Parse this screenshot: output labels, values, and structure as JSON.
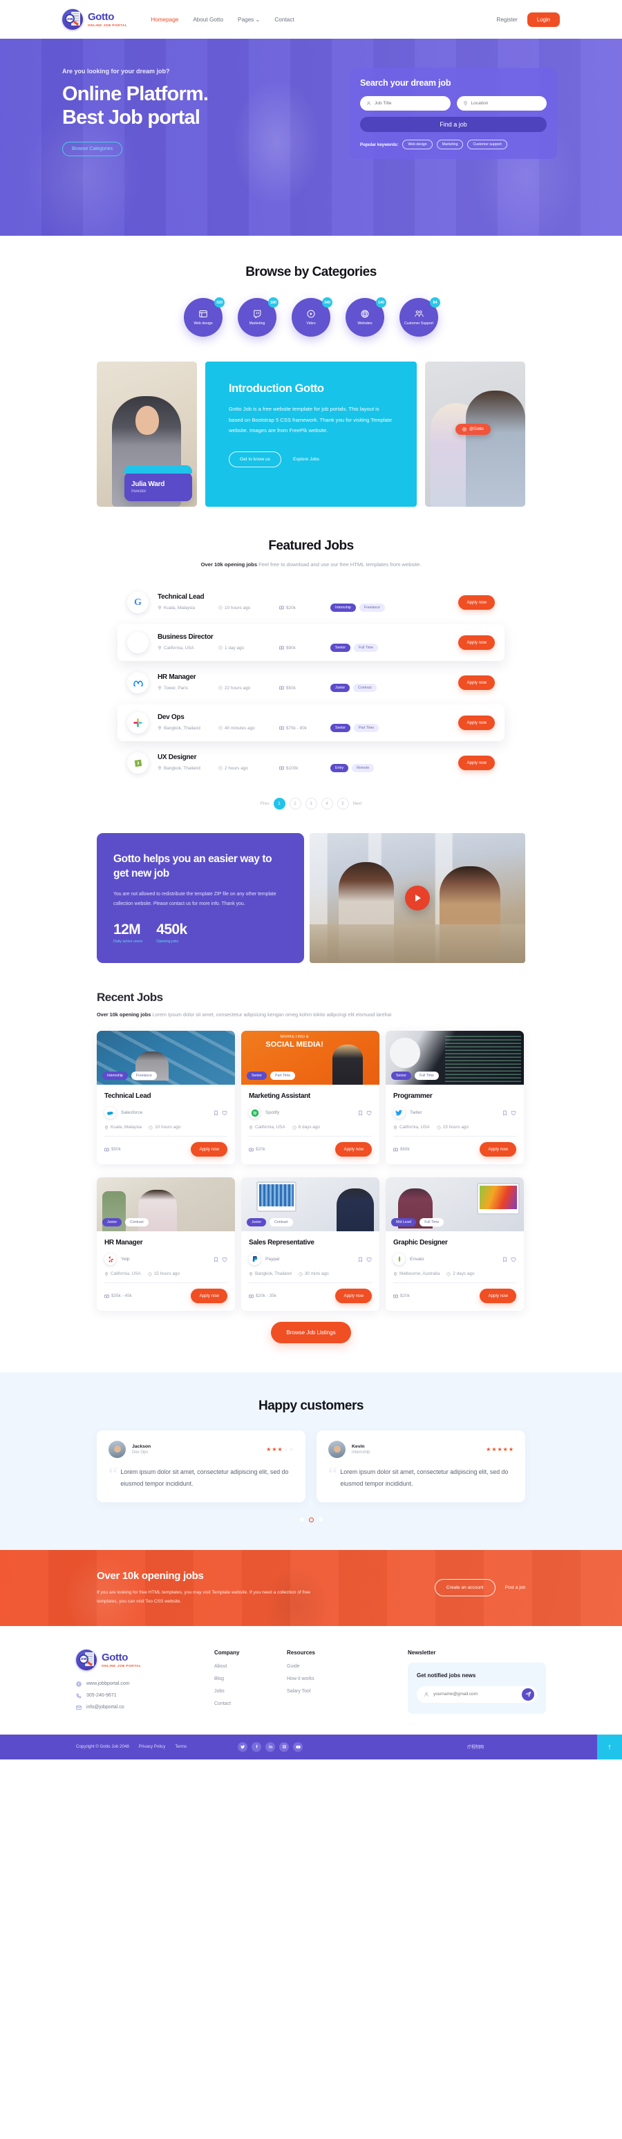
{
  "nav": {
    "brand": {
      "name": "Gotto",
      "tagline": "ONLINE JOB PORTAL"
    },
    "links": [
      {
        "label": "Homepage",
        "active": true
      },
      {
        "label": "About Gotto",
        "active": false
      },
      {
        "label": "Pages",
        "active": false,
        "caret": true
      },
      {
        "label": "Contact",
        "active": false
      }
    ],
    "register_label": "Register",
    "login_label": "Login"
  },
  "hero": {
    "kicker": "Are you looking for your dream job?",
    "title_line1": "Online Platform.",
    "title_line2": "Best Job portal",
    "browse_button": "Browse Categories",
    "search": {
      "title": "Search your dream job",
      "job_placeholder": "Job Title",
      "location_placeholder": "Location",
      "find_label": "Find a job",
      "keywords_label": "Popular keywords:",
      "keywords": [
        "Web design",
        "Marketing",
        "Customer support"
      ]
    }
  },
  "categories": {
    "title": "Browse by Categories",
    "items": [
      {
        "label": "Web design",
        "count": "320",
        "icon": "window-icon"
      },
      {
        "label": "Marketing",
        "count": "180",
        "icon": "twitch-icon"
      },
      {
        "label": "Video",
        "count": "340",
        "icon": "play-icon"
      },
      {
        "label": "Websites",
        "count": "140",
        "icon": "globe-icon"
      },
      {
        "label": "Customer Support",
        "count": "84",
        "icon": "people-icon"
      }
    ]
  },
  "intro": {
    "person_name": "Julia Ward",
    "person_role": "Investor",
    "title": "Introduction Gotto",
    "body": "Gotto Job is a free website template for job portals. This layout is based on Bootstrap 5 CSS framework. Thank you for visiting Template website. Images are from FreePik website.",
    "primary_button": "Get to know us",
    "secondary_link": "Explore Jobs",
    "instagram_chip": "@Gotto"
  },
  "featured": {
    "title": "Featured Jobs",
    "sub_bold": "Over 10k opening jobs",
    "sub_rest": " Feel free to download and use our free HTML templates from website.",
    "apply_label": "Apply now",
    "jobs": [
      {
        "title": "Technical Lead",
        "location": "Kuala, Malaysia",
        "time": "10 hours ago",
        "pay": "$20k",
        "tag_solid": "Internship",
        "tag_soft": "Freelance",
        "logo": "google-icon"
      },
      {
        "title": "Business Director",
        "location": "California, USA",
        "time": "1 day ago",
        "pay": "$90k",
        "tag_solid": "Senior",
        "tag_soft": "Full Time",
        "logo": "apple-icon"
      },
      {
        "title": "HR Manager",
        "location": "Tower, Paris",
        "time": "22 hours ago",
        "pay": "$50k",
        "tag_solid": "Junior",
        "tag_soft": "Contract",
        "logo": "meta-icon"
      },
      {
        "title": "Dev Ops",
        "location": "Bangkok, Thailand",
        "time": "40 minutes ago",
        "pay": "$75k - 80k",
        "tag_solid": "Senior",
        "tag_soft": "Part Time",
        "logo": "slack-icon"
      },
      {
        "title": "UX Designer",
        "location": "Bangkok, Thailand",
        "time": "2 hours ago",
        "pay": "$100k",
        "tag_solid": "Entry",
        "tag_soft": "Remote",
        "logo": "envato-icon"
      }
    ],
    "pagination": {
      "prev": "Prev",
      "pages": [
        "1",
        "2",
        "3",
        "4",
        "5"
      ],
      "current": "1",
      "next": "Next"
    }
  },
  "promo": {
    "title": "Gotto helps you an easier way to get new job",
    "body": "You are not allowed to redistribute the template ZIP file on any other template collection website. Please contact us for more info. Thank you.",
    "stats": [
      {
        "value": "12M",
        "label": "Daily active users"
      },
      {
        "value": "450k",
        "label": "Opening jobs"
      }
    ],
    "play_icon": "youtube-play-icon"
  },
  "recent": {
    "title": "Recent Jobs",
    "sub_bold": "Over 10k opening jobs",
    "sub_rest": " Lorem Ipsum dolor sit amet, consectetur adipsicing kengan omeg kohm tokito adipcingi elit eismuod larehai",
    "apply_label": "Apply now",
    "browse_label": "Browse Job Listings",
    "cards": [
      {
        "title": "Technical Lead",
        "company": "Salesforce",
        "location": "Kuala, Malaysia",
        "time": "10 hours ago",
        "pay": "$50k",
        "tag_solid": "Internship",
        "tag_soft": "Freelance",
        "logo": "salesforce-icon"
      },
      {
        "title": "Marketing Assistant",
        "company": "Spotify",
        "location": "California, USA",
        "time": "8 days ago",
        "pay": "$20k",
        "tag_solid": "Senior",
        "tag_soft": "Part Time",
        "logo": "spotify-icon"
      },
      {
        "title": "Programmer",
        "company": "Twiter",
        "location": "California, USA",
        "time": "23 hours ago",
        "pay": "$68k",
        "tag_solid": "Senior",
        "tag_soft": "Full Time",
        "logo": "twitter-icon"
      },
      {
        "title": "HR Manager",
        "company": "Yelp",
        "location": "California, USA",
        "time": "15 hours ago",
        "pay": "$35k - 45k",
        "tag_solid": "Junior",
        "tag_soft": "Contract",
        "logo": "yelp-icon"
      },
      {
        "title": "Sales Representative",
        "company": "Paypal",
        "location": "Bangkok, Thailand",
        "time": "30 mins ago",
        "pay": "$20k - 35k",
        "tag_solid": "Junior",
        "tag_soft": "Contract",
        "logo": "paypal-icon"
      },
      {
        "title": "Graphic Designer",
        "company": "Envato",
        "location": "Melbourne, Australia",
        "time": "2 days ago",
        "pay": "$20k",
        "tag_solid": "Mid Level",
        "tag_soft": "Full Time",
        "logo": "envato-icon"
      }
    ]
  },
  "testimonials": {
    "title": "Happy customers",
    "items": [
      {
        "name": "Jackson",
        "role": "Dev Ops",
        "rating": 3,
        "text": "Lorem ipsum dolor sit amet, consectetur adipiscing elit, sed do eiusmod tempor incididunt."
      },
      {
        "name": "Kevin",
        "role": "Internship",
        "rating": 5,
        "text": "Lorem ipsum dolor sit amet, consectetur adipiscing elit, sed do eiusmod tempor incididunt."
      }
    ],
    "dots": 3,
    "current_dot": 1
  },
  "cta": {
    "title": "Over 10k opening jobs",
    "body": "If you are looking for free HTML templates, you may visit Template website. If you need a collection of free templates, you can visit Too CSS website.",
    "primary_button": "Create an account",
    "secondary_link": "Post a job"
  },
  "footer": {
    "brand": {
      "name": "Gotto",
      "tagline": "ONLINE JOB PORTAL"
    },
    "contact": [
      {
        "icon": "globe-icon",
        "text": "www.jobbportal.com"
      },
      {
        "icon": "phone-icon",
        "text": "305-240-9671"
      },
      {
        "icon": "mail-icon",
        "text": "info@jobportal.co"
      }
    ],
    "columns": [
      {
        "heading": "Company",
        "links": [
          "About",
          "Blog",
          "Jobs",
          "Contact"
        ]
      },
      {
        "heading": "Resources",
        "links": [
          "Guide",
          "How it works",
          "Salary Tool"
        ]
      }
    ],
    "newsletter": {
      "heading": "Newsletter",
      "title": "Get notified jobs news",
      "placeholder": "yourname@gmail.com",
      "send_icon": "send-icon"
    },
    "bottom": {
      "copyright": "Copyright © Gotto Job 2048",
      "links": [
        "Privacy Policy",
        "Terms"
      ],
      "socials": [
        "twitter-icon",
        "facebook-icon",
        "linkedin-icon",
        "instagram-icon",
        "youtube-icon"
      ],
      "cjk": "疗程制网",
      "to_top_icon": "arrow-up-icon"
    }
  }
}
